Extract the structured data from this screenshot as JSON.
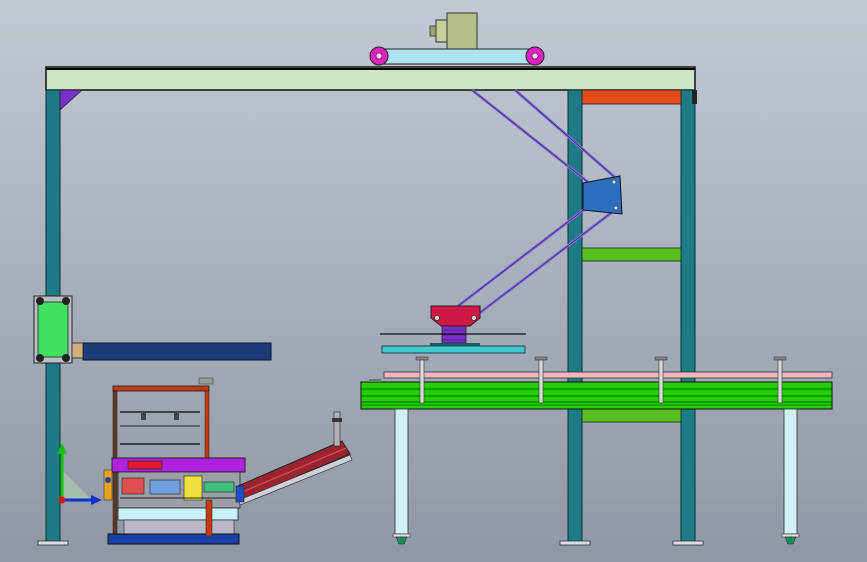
{
  "scene": {
    "kind": "cad-assembly-side-view",
    "background": {
      "top": "#c3c9d3",
      "bottom": "#8f97a6"
    },
    "colors": {
      "frame_column": "#1e7a86",
      "top_beam": "#cde6c3",
      "motor": "#b8c08a",
      "trolley_rail": "#aee2ee",
      "wheel": "#e020c0",
      "accent_orange": "#e44a18",
      "accent_green": "#58c020",
      "bracket_blue": "#2a6fbf",
      "link_arm": "#8a70d8",
      "gripper_red": "#d01848",
      "gripper_purple": "#7a30c8",
      "gripper_plate": "#3ec9cf",
      "arm_beam": "#1f3c7a",
      "conveyor_green": "#22d000",
      "conveyor_top": "#f2b5be",
      "conveyor_leg": "#d2eef6",
      "machine_red": "#d03a10",
      "machine_purple": "#b020e0",
      "machine_blue": "#1a3fa8",
      "chute_red": "#9a2430",
      "triad_x": "#1030d0",
      "triad_y": "#10c010",
      "triad_z": "#e01010"
    },
    "triad": [
      "x-axis",
      "y-axis",
      "z-axis"
    ]
  }
}
